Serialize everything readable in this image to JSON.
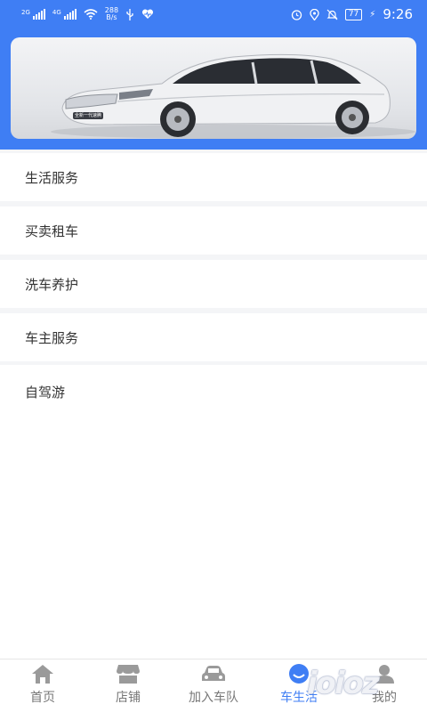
{
  "status_bar": {
    "network_1": "2G",
    "network_2": "4G",
    "speed_value": "288",
    "speed_unit": "B/s",
    "battery": "77",
    "time": "9:26"
  },
  "banner": {
    "car_plate": "全新一代速腾"
  },
  "menu": {
    "items": [
      {
        "label": "生活服务"
      },
      {
        "label": "买卖租车"
      },
      {
        "label": "洗车养护"
      },
      {
        "label": "车主服务"
      },
      {
        "label": "自驾游"
      }
    ]
  },
  "tabbar": {
    "active_tab": "车生活",
    "tabs": [
      {
        "label": "首页",
        "icon": "home-icon"
      },
      {
        "label": "店铺",
        "icon": "store-icon"
      },
      {
        "label": "加入车队",
        "icon": "car-icon"
      },
      {
        "label": "车生活",
        "icon": "car-life-icon"
      },
      {
        "label": "我的",
        "icon": "profile-icon"
      }
    ]
  },
  "watermark": "ioioz",
  "colors": {
    "brand_blue": "#3f7ef4",
    "menu_text": "#333333",
    "tab_inactive": "#777777"
  }
}
